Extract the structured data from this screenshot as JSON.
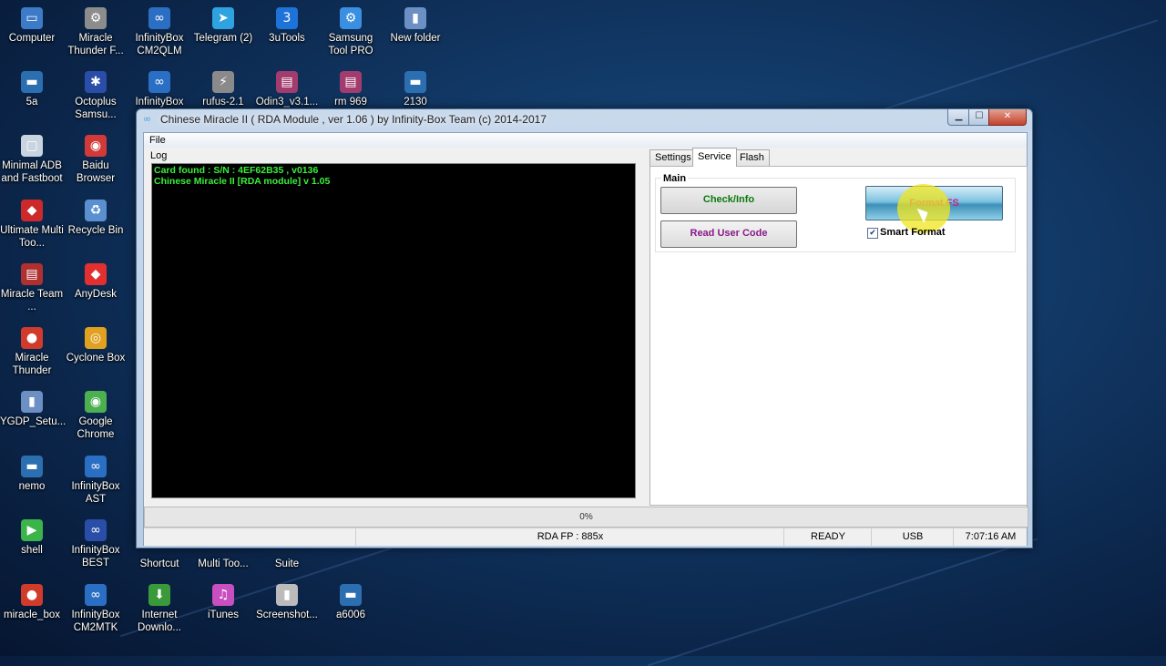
{
  "desktop": {
    "icons": [
      {
        "label": "Computer",
        "icon": "computer-icon",
        "color": "#3d7bc8"
      },
      {
        "label": "Miracle Thunder F...",
        "icon": "gear-icon",
        "color": "#8c8c8c"
      },
      {
        "label": "InfinityBox CM2QLM",
        "icon": "infinity-icon",
        "color": "#2a6fc4"
      },
      {
        "label": "Telegram (2)",
        "icon": "telegram-icon",
        "color": "#2fa3e0"
      },
      {
        "label": "3uTools",
        "icon": "3utools-icon",
        "color": "#1e73d8"
      },
      {
        "label": "Samsung Tool PRO",
        "icon": "samsung-tool-icon",
        "color": "#3b8fe0"
      },
      {
        "label": "New folder",
        "icon": "folder-icon",
        "color": "#6c8fc4"
      },
      {
        "label": "5a",
        "icon": "device-icon",
        "color": "#2c6fb0"
      },
      {
        "label": "Octoplus Samsu...",
        "icon": "octoplus-icon",
        "color": "#2a4ea8"
      },
      {
        "label": "InfinityBox",
        "icon": "infinity-icon",
        "color": "#2a6fc4"
      },
      {
        "label": "rufus-2.1",
        "icon": "usb-icon",
        "color": "#8a8a8a"
      },
      {
        "label": "Odin3_v3.1...",
        "icon": "archive-icon",
        "color": "#a33c6e"
      },
      {
        "label": "rm 969",
        "icon": "archive-icon",
        "color": "#a33c6e"
      },
      {
        "label": "2130",
        "icon": "device-icon",
        "color": "#2c6fb0"
      },
      {
        "label": "Minimal ADB and Fastboot",
        "icon": "window-icon",
        "color": "#c8d4e0"
      },
      {
        "label": "Baidu Browser",
        "icon": "baidu-icon",
        "color": "#d23a3a"
      },
      {
        "label": "Ultimate Multi Too...",
        "icon": "shield-icon",
        "color": "#cc2a2a"
      },
      {
        "label": "Recycle Bin",
        "icon": "recycle-bin-icon",
        "color": "#5a8fd0"
      },
      {
        "label": "Miracle Team ...",
        "icon": "book-icon",
        "color": "#b03030"
      },
      {
        "label": "AnyDesk",
        "icon": "anydesk-icon",
        "color": "#e23030"
      },
      {
        "label": "Miracle Thunder",
        "icon": "miracle-icon",
        "color": "#d03b2b"
      },
      {
        "label": "Cyclone Box",
        "icon": "cyclone-icon",
        "color": "#e0a020"
      },
      {
        "label": "YGDP_Setu...",
        "icon": "folder-icon",
        "color": "#6c8fc4"
      },
      {
        "label": "Google Chrome",
        "icon": "chrome-icon",
        "color": "#4caf50"
      },
      {
        "label": "nemo",
        "icon": "device-icon",
        "color": "#2c6fb0"
      },
      {
        "label": "InfinityBox AST",
        "icon": "infinity-icon",
        "color": "#2a6fc4"
      },
      {
        "label": "shell",
        "icon": "play-icon",
        "color": "#3bb54a"
      },
      {
        "label": "InfinityBox BEST",
        "icon": "infinity-icon",
        "color": "#2a4ea8"
      },
      {
        "label": "miracle_box",
        "icon": "miracle-icon",
        "color": "#d03b2b"
      },
      {
        "label": "InfinityBox CM2MTK",
        "icon": "infinity-icon",
        "color": "#2a6fc4"
      },
      {
        "label": "Internet Downlo...",
        "icon": "download-icon",
        "color": "#3a9a3a"
      },
      {
        "label": "iTunes",
        "icon": "itunes-icon",
        "color": "#c84fc0"
      },
      {
        "label": "Screenshot...",
        "icon": "mouse-icon",
        "color": "#bbbbbb"
      },
      {
        "label": "a6006",
        "icon": "device-icon",
        "color": "#2c6fb0"
      },
      {
        "label": "Shortcut",
        "icon": "none",
        "color": "#000000"
      },
      {
        "label": "Multi Too...",
        "icon": "none",
        "color": "#000000"
      },
      {
        "label": "Suite",
        "icon": "none",
        "color": "#000000"
      }
    ]
  },
  "window": {
    "title": "Chinese Miracle II ( RDA Module , ver 1.06 ) by Infinity-Box Team (c) 2014-2017",
    "controls": {
      "minimize": "▁",
      "maximize": "☐",
      "close": "✕"
    }
  },
  "menu": {
    "file": "File"
  },
  "log": {
    "label": "Log",
    "lines": [
      "Card found : S/N : 4EF62B35 , v0136",
      "Chinese Miracle II [RDA module] v 1.05"
    ],
    "text_color": "#3bf03b"
  },
  "tabs": [
    {
      "label": "Settings",
      "active": false
    },
    {
      "label": "Service",
      "active": true
    },
    {
      "label": "Flash",
      "active": false
    }
  ],
  "main_group": {
    "label": "Main",
    "check_info": "Check/Info",
    "read_user_code": "Read User Code",
    "format_fs": "Format FS",
    "smart_format_label": "Smart Format",
    "smart_format_checked": true,
    "check_mark": "✔"
  },
  "progress": {
    "text": "0%",
    "value": 0
  },
  "status": {
    "fp": "RDA FP : 885x",
    "state": "READY",
    "port": "USB",
    "time": "7:07:16 AM"
  }
}
